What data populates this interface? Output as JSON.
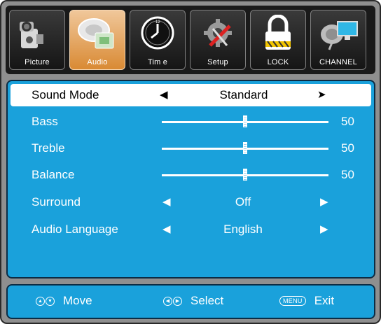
{
  "tabs": [
    {
      "label": "Picture",
      "icon": "camera-icon",
      "active": false
    },
    {
      "label": "Audio",
      "icon": "speaker-icon",
      "active": true
    },
    {
      "label": "Tim e",
      "icon": "clock-icon",
      "active": false
    },
    {
      "label": "Setup",
      "icon": "tools-icon",
      "active": false
    },
    {
      "label": "LOCK",
      "icon": "lock-icon",
      "active": false
    },
    {
      "label": "CHANNEL",
      "icon": "satellite-icon",
      "active": false
    }
  ],
  "menu": {
    "sound_mode": {
      "label": "Sound Mode",
      "value": "Standard"
    },
    "bass": {
      "label": "Bass",
      "value": "50",
      "level": 50
    },
    "treble": {
      "label": "Treble",
      "value": "50",
      "level": 50
    },
    "balance": {
      "label": "Balance",
      "value": "50",
      "level": 50
    },
    "surround": {
      "label": "Surround",
      "value": "Off"
    },
    "audio_language": {
      "label": "Audio Language",
      "value": "English"
    }
  },
  "footer": {
    "move_label": "Move",
    "select_label": "Select",
    "menu_key": "MENU",
    "exit_label": "Exit"
  },
  "colors": {
    "panel": "#1aa1db",
    "active_tab": "#e0954a",
    "frame": "#8f8f8f"
  }
}
